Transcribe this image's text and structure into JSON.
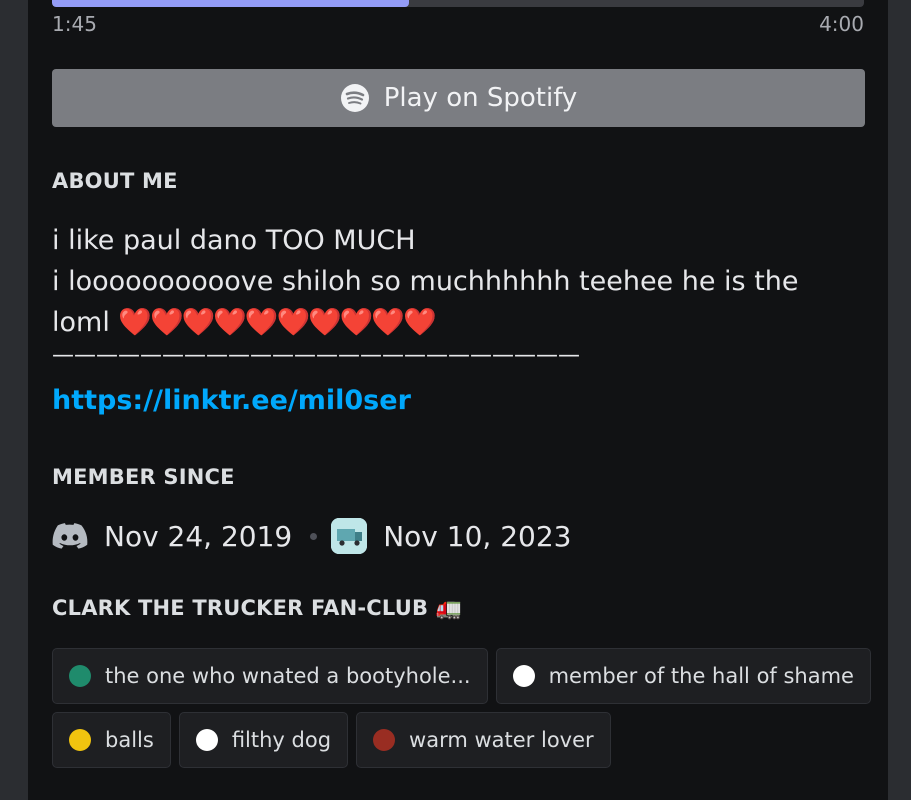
{
  "player": {
    "progress": 0.44,
    "elapsed": "1:45",
    "duration": "4:00",
    "button_label": "Play on Spotify",
    "accent": "#949cf7"
  },
  "about": {
    "title": "ABOUT ME",
    "line1": "i like paul dano TOO MUCH",
    "line2": "i loooooooooove shiloh so muchhhhhh teehee he is the",
    "line3_text": "loml",
    "hearts": "❤️❤️❤️❤️❤️❤️❤️❤️❤️❤️",
    "divider": "————————————————————————",
    "link": "https://linktr.ee/mil0ser",
    "link_color": "#00a8fc"
  },
  "member_since": {
    "title": "MEMBER SINCE",
    "discord_date": "Nov 24, 2019",
    "server_date": "Nov 10, 2023"
  },
  "server": {
    "title": "CLARK THE TRUCKER FAN-CLUB 🚛",
    "roles": [
      {
        "name": "the one who wnated a bootyhole...",
        "color": "#1f8b6c"
      },
      {
        "name": "member of the hall of shame",
        "color": "#ffffff"
      },
      {
        "name": "balls",
        "color": "#f1c40f"
      },
      {
        "name": "filthy dog",
        "color": "#ffffff"
      },
      {
        "name": "warm water lover",
        "color": "#992d22"
      }
    ]
  }
}
